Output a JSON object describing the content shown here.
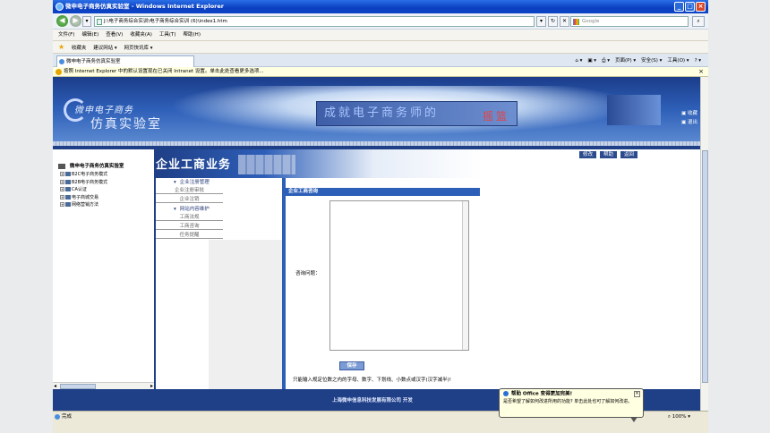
{
  "window": {
    "title": "微申电子商务仿真实验室 - Windows Internet Explorer",
    "address": "J:\\电子商务综合实训\\电子商务综合实训 (6)\\index1.htm",
    "search_placeholder": "Google"
  },
  "menu": [
    "文件(F)",
    "编辑(E)",
    "查看(V)",
    "收藏夹(A)",
    "工具(T)",
    "帮助(H)"
  ],
  "favorites": {
    "label": "收藏夹",
    "items": [
      "建议网站 ▾",
      "网页快讯库 ▾"
    ]
  },
  "tab": {
    "label": "微申电子商务仿真实验室"
  },
  "command_bar": [
    "页面(P) ▾",
    "安全(S) ▾",
    "工具(O) ▾"
  ],
  "info_bar": {
    "text": "按照 Internet Explorer 中的默认设置现在已关闭 Intranet 设置。单击此处查看更多选项..."
  },
  "banner": {
    "logo_line1": "微申电子商务",
    "logo_line2": "仿真实验室",
    "slogan": "成就电子商务师的",
    "slogan_stamp": "摇篮",
    "links": [
      "收藏",
      "退出"
    ]
  },
  "sidebar": {
    "root": "微申电子商务仿真实验室",
    "items": [
      "B2C电子商务模式",
      "B2B电子商务模式",
      "CA认证",
      "电子商城交易",
      "网络营销方法"
    ]
  },
  "header": {
    "title": "企业工商业务",
    "buttons": [
      "修改",
      "帮助",
      "返回"
    ]
  },
  "submenu": {
    "group1": "企业注册管理",
    "group1_items": [
      "企业注册审批",
      "企业注销"
    ],
    "group2": "网站内容维护",
    "group2_items": [
      "工商法规",
      "工商咨询",
      "任务提醒"
    ]
  },
  "form": {
    "section_title": "企业工商咨询",
    "question_label": "咨询问题：",
    "question_value": "",
    "save_label": "保存",
    "hint": "只能输入规定位数之内的字母、数字、下划线、小数点或汉字(汉字减半)!"
  },
  "footer": {
    "text": "上海微申信息科技发展有限公司  开发"
  },
  "status": {
    "text": "完成",
    "zoom": "100%"
  },
  "office_popup": {
    "title": "帮助 Office 变得更加完美!",
    "body": "是否希望了解如何改进所用的功能? 单击此处也可了解如何改进。"
  }
}
